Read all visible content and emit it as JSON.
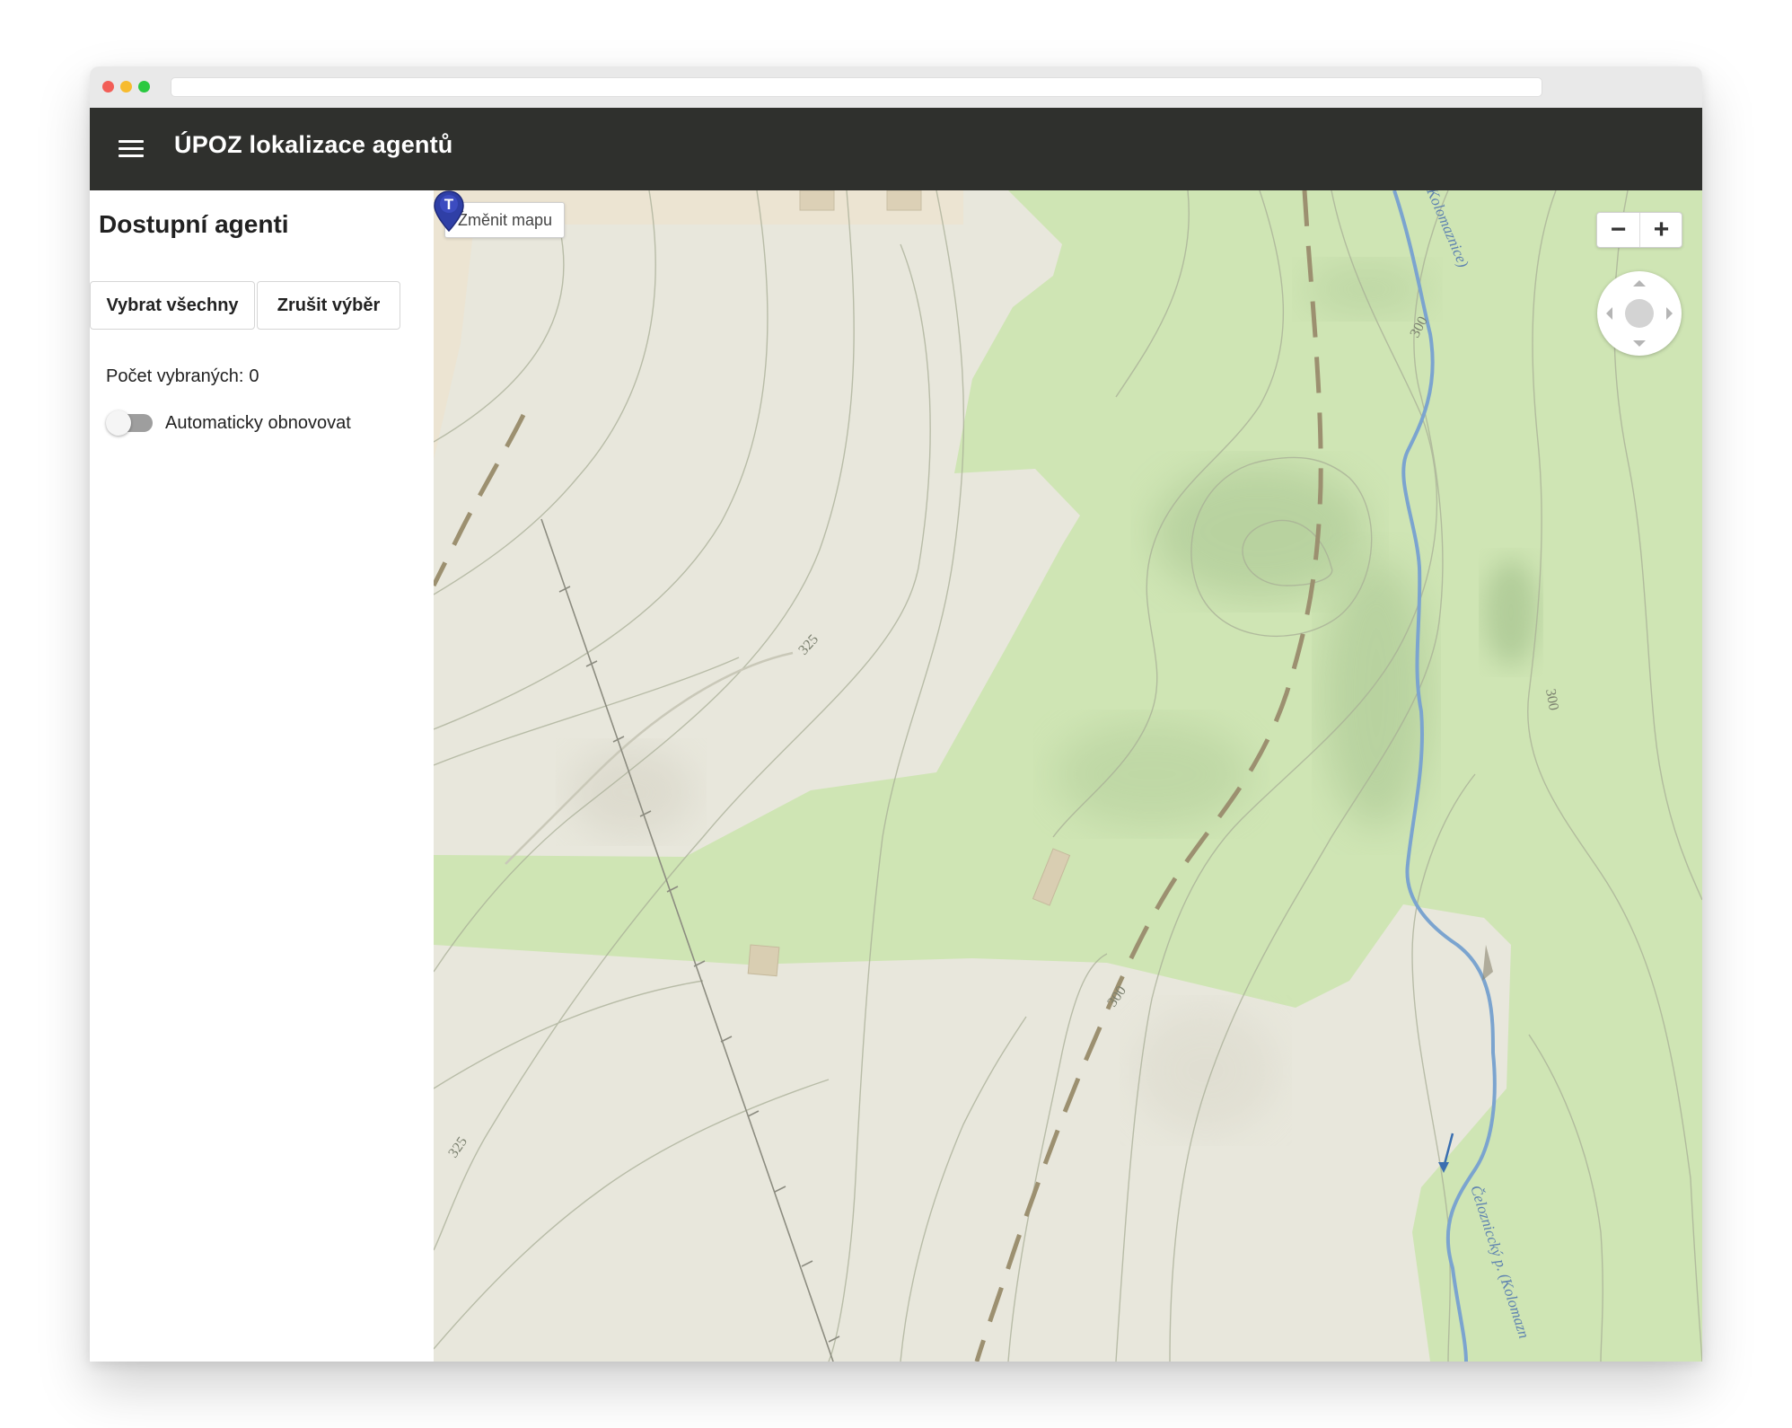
{
  "app": {
    "title": "ÚPOZ lokalizace agentů"
  },
  "sidebar": {
    "heading": "Dostupní agenti",
    "select_all_label": "Vybrat všechny",
    "clear_selection_label": "Zrušit výběr",
    "selected_count_label": "Počet vybraných:",
    "selected_count": "0",
    "auto_refresh_label": "Automaticky obnovovat",
    "auto_refresh_on": false
  },
  "map": {
    "change_map_label": "Změnit mapu",
    "zoom_out_symbol": "−",
    "zoom_in_symbol": "+",
    "marker_letter": "T",
    "contour_labels": [
      "325",
      "300",
      "300",
      "325",
      "300"
    ],
    "stream_label_top": "Kolomaznice)",
    "stream_label_bottom": "Čelozniccký p. (Kolomazn",
    "colors": {
      "field": "#e8e7dc",
      "forest": "#cfe5b4",
      "water": "#7ba4cf",
      "path": "#9c9070",
      "marker": "#2f3fa6"
    }
  }
}
